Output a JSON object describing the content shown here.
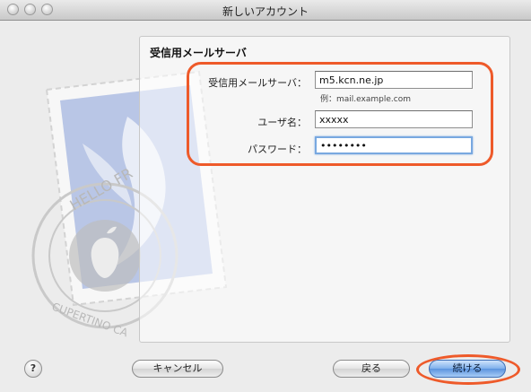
{
  "window": {
    "title": "新しいアカウント"
  },
  "section": {
    "title": "受信用メールサーバ"
  },
  "form": {
    "server_label": "受信用メールサーバ：",
    "server_value": "m5.kcn.ne.jp",
    "server_hint": "例：mail.example.com",
    "username_label": "ユーザ名：",
    "username_value": "xxxxx",
    "password_label": "パスワード：",
    "password_value": "••••••••"
  },
  "buttons": {
    "help": "?",
    "cancel": "キャンセル",
    "back": "戻る",
    "continue": "続ける"
  },
  "colors": {
    "highlight": "#ee5a2a",
    "focus_ring": "#78a8e0",
    "default_button": "#5b93de"
  },
  "stamp": {
    "icon": "mail-stamp-icon"
  }
}
